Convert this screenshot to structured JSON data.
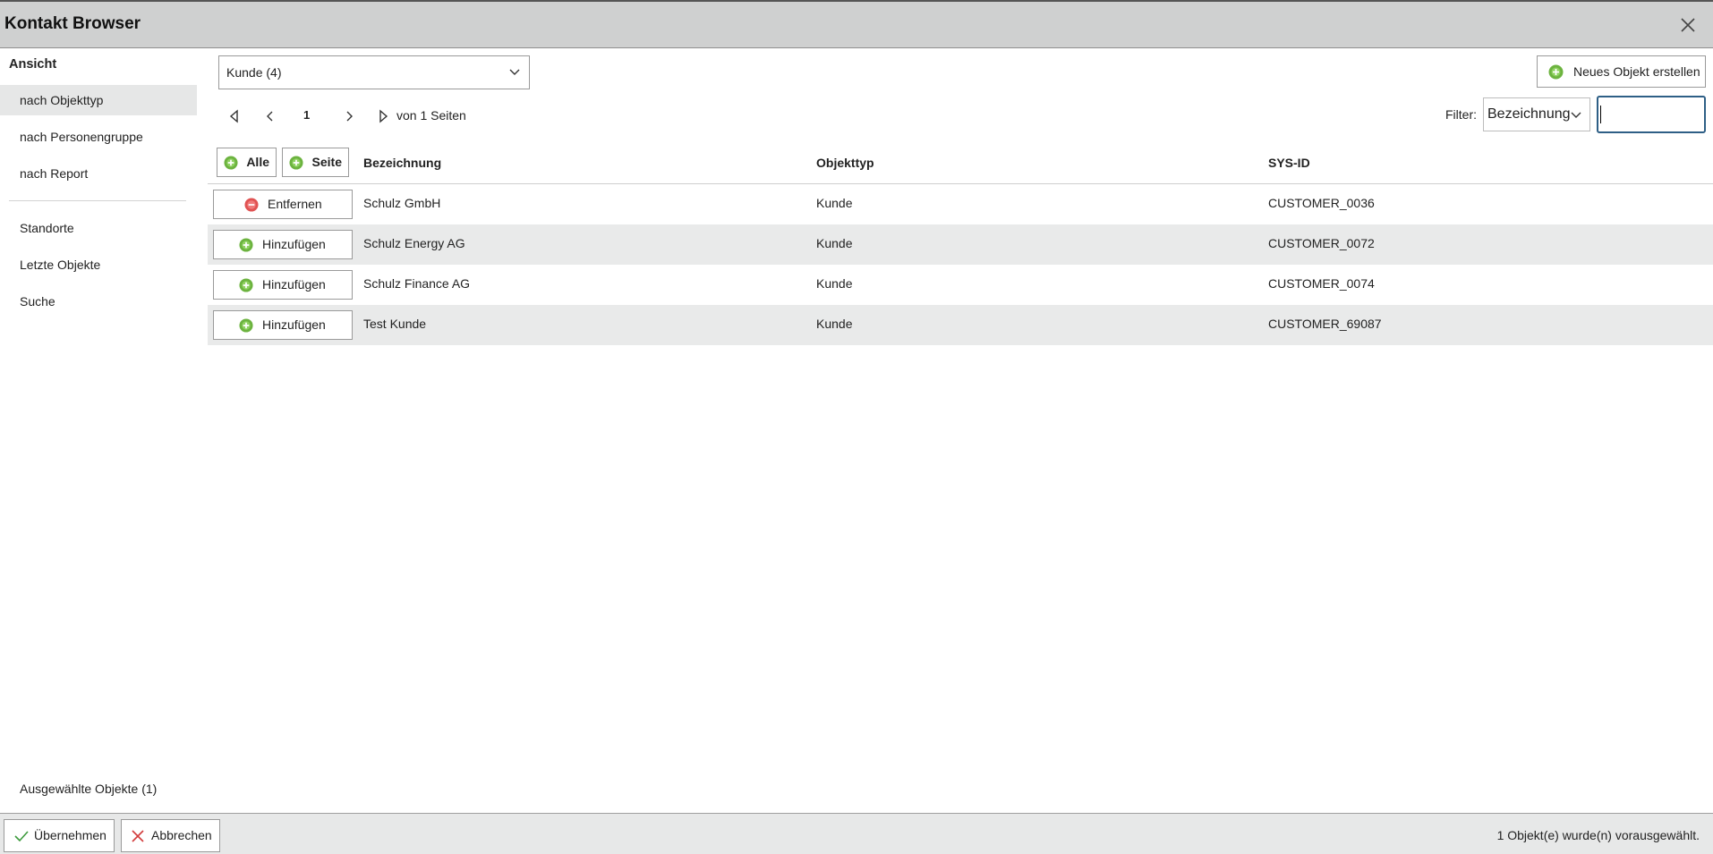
{
  "window": {
    "title": "Kontakt Browser"
  },
  "sidebar": {
    "heading": "Ansicht",
    "items": [
      {
        "label": "nach Objekttyp"
      },
      {
        "label": "nach Personengruppe"
      },
      {
        "label": "nach Report"
      },
      {
        "label": "Standorte"
      },
      {
        "label": "Letzte Objekte"
      },
      {
        "label": "Suche"
      }
    ],
    "selected_objects": "Ausgewählte Objekte (1)"
  },
  "toolbar": {
    "type_select_value": "Kunde (4)",
    "new_object_label": "Neues Objekt erstellen",
    "filter_label": "Filter:",
    "filter_field_value": "Bezeichnung",
    "filter_input_value": ""
  },
  "pager": {
    "current_page": "1",
    "pages_text": "von 1 Seiten"
  },
  "table": {
    "all_label": "Alle",
    "page_label": "Seite",
    "columns": [
      "Bezeichnung",
      "Objekttyp",
      "SYS-ID"
    ],
    "rows": [
      {
        "action": "Entfernen",
        "name": "Schulz GmbH",
        "type": "Kunde",
        "sysid": "CUSTOMER_0036"
      },
      {
        "action": "Hinzufügen",
        "name": "Schulz Energy AG",
        "type": "Kunde",
        "sysid": "CUSTOMER_0072"
      },
      {
        "action": "Hinzufügen",
        "name": "Schulz Finance AG",
        "type": "Kunde",
        "sysid": "CUSTOMER_0074"
      },
      {
        "action": "Hinzufügen",
        "name": "Test Kunde",
        "type": "Kunde",
        "sysid": "CUSTOMER_69087"
      }
    ]
  },
  "footer": {
    "apply_label": "Übernehmen",
    "cancel_label": "Abbrechen",
    "status": "1 Objekt(e) wurde(n) vorausgewählt."
  },
  "colors": {
    "add_green": "#6cb33f",
    "remove_red": "#e05252",
    "focus_blue": "#2e5f86"
  }
}
